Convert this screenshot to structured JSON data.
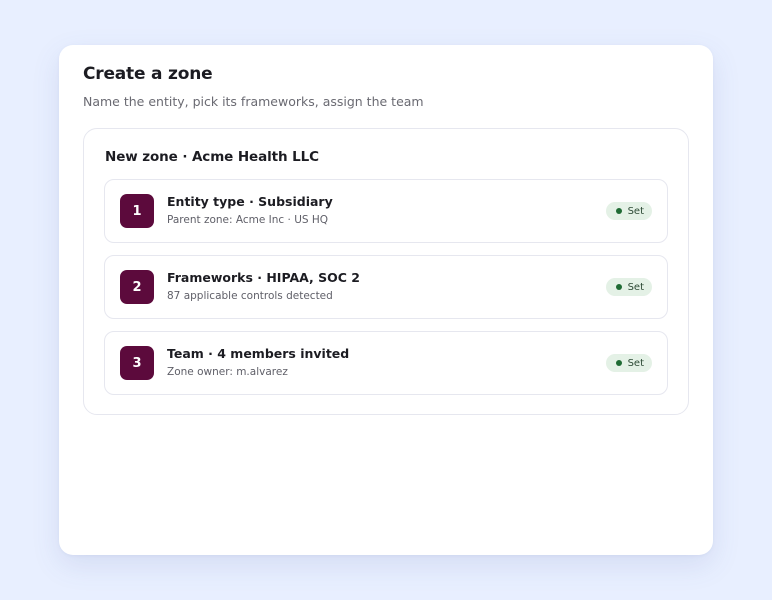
{
  "dialog": {
    "title": "Create a zone",
    "subtitle": "Name the entity, pick its frameworks, assign the team"
  },
  "zone": {
    "heading": "New zone · Acme Health LLC",
    "steps": [
      {
        "number": "1",
        "title": "Entity type · Subsidiary",
        "description": "Parent zone: Acme Inc · US HQ",
        "status": "Set"
      },
      {
        "number": "2",
        "title": "Frameworks · HIPAA, SOC 2",
        "description": "87 applicable controls detected",
        "status": "Set"
      },
      {
        "number": "3",
        "title": "Team · 4 members invited",
        "description": "Zone owner: m.alvarez",
        "status": "Set"
      }
    ]
  },
  "colors": {
    "page_background": "#e8efff",
    "step_number_background": "#5c0a3c",
    "status_badge_background": "#e4f1e6",
    "status_dot": "#1f6b34"
  }
}
